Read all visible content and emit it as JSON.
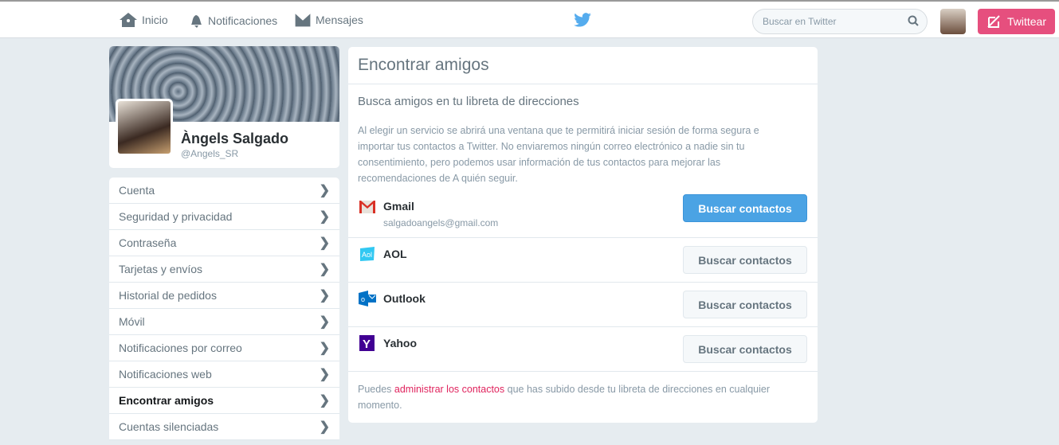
{
  "nav": {
    "home": "Inicio",
    "notifications": "Notificaciones",
    "messages": "Mensajes"
  },
  "search": {
    "placeholder": "Buscar en Twitter"
  },
  "tweet_label": "Twittear",
  "profile": {
    "name": "Àngels Salgado",
    "handle": "@Angels_SR"
  },
  "menu": [
    "Cuenta",
    "Seguridad y privacidad",
    "Contraseña",
    "Tarjetas y envíos",
    "Historial de pedidos",
    "Móvil",
    "Notificaciones por correo",
    "Notificaciones web",
    "Encontrar amigos",
    "Cuentas silenciadas"
  ],
  "main": {
    "title": "Encontrar amigos",
    "subtitle": "Busca amigos en tu libreta de direcciones",
    "description": "Al elegir un servicio se abrirá una ventana que te permitirá iniciar sesión de forma segura e importar tus contactos a Twitter. No enviaremos ningún correo electrónico a nadie sin tu consentimiento, pero podemos usar información de tus contactos para mejorar las recomendaciones de A quién seguir.",
    "services": [
      {
        "name": "Gmail",
        "email": "salgadoangels@gmail.com",
        "button": "Buscar contactos"
      },
      {
        "name": "AOL",
        "button": "Buscar contactos"
      },
      {
        "name": "Outlook",
        "button": "Buscar contactos"
      },
      {
        "name": "Yahoo",
        "button": "Buscar contactos"
      }
    ],
    "footer_pre": "Puedes ",
    "footer_link": "administrar los contactos",
    "footer_post": " que has subido desde tu libreta de direcciones en cualquier momento."
  }
}
